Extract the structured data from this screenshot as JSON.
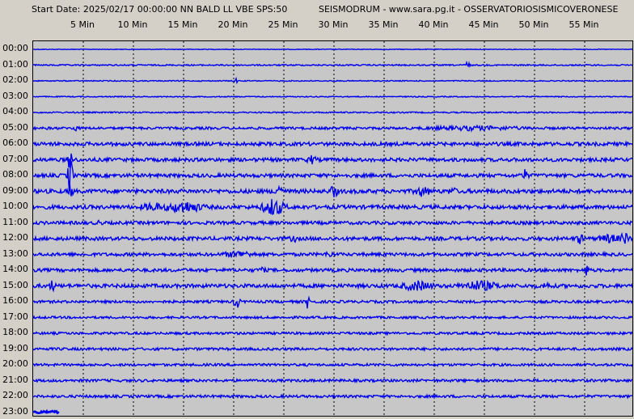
{
  "header": {
    "start_info": "Start Date: 2025/02/17 00:00:00 NN BALD LL VBE SPS:50",
    "station_info": "SEISMODRUM - www.sara.pg.it - OSSERVATORIOSISMICOVERONESE"
  },
  "minute_labels": [
    "5 Min",
    "10 Min",
    "15 Min",
    "20 Min",
    "25 Min",
    "30 Min",
    "35 Min",
    "40 Min",
    "45 Min",
    "50 Min",
    "55 Min"
  ],
  "hour_labels": [
    "00:00",
    "01:00",
    "02:00",
    "03:00",
    "04:00",
    "05:00",
    "06:00",
    "07:00",
    "08:00",
    "09:00",
    "10:00",
    "11:00",
    "12:00",
    "13:00",
    "14:00",
    "15:00",
    "16:00",
    "17:00",
    "18:00",
    "19:00",
    "20:00",
    "21:00",
    "22:00",
    "23:00"
  ],
  "colors": {
    "trace": "#0000ee",
    "background": "#c7c7c7",
    "grid": "#000000",
    "frame": "#d4d0c8"
  },
  "traces": [
    {
      "hour": "00:00",
      "noise": 0.4,
      "events": []
    },
    {
      "hour": "01:00",
      "noise": 0.8,
      "events": [
        {
          "min": 43.3,
          "amp": 6,
          "dur": 0.3
        }
      ]
    },
    {
      "hour": "02:00",
      "noise": 0.6,
      "events": [
        {
          "min": 20.2,
          "amp": 3,
          "dur": 0.3
        }
      ]
    },
    {
      "hour": "03:00",
      "noise": 0.6,
      "events": []
    },
    {
      "hour": "04:00",
      "noise": 0.8,
      "events": []
    },
    {
      "hour": "05:00",
      "noise": 1.5,
      "events": [
        {
          "min": 4.2,
          "amp": 4,
          "dur": 0.3
        },
        {
          "min": 44,
          "amp": 2,
          "dur": 6
        }
      ]
    },
    {
      "hour": "06:00",
      "noise": 2.2,
      "events": []
    },
    {
      "hour": "07:00",
      "noise": 2.2,
      "events": [
        {
          "min": 3.7,
          "amp": 18,
          "dur": 0.3
        },
        {
          "min": 27.8,
          "amp": 4,
          "dur": 0.6
        }
      ]
    },
    {
      "hour": "08:00",
      "noise": 2.2,
      "events": [
        {
          "min": 3.7,
          "amp": 24,
          "dur": 0.4
        },
        {
          "min": 49,
          "amp": 6,
          "dur": 0.5
        }
      ]
    },
    {
      "hour": "09:00",
      "noise": 2.5,
      "events": [
        {
          "min": 3.7,
          "amp": 14,
          "dur": 0.3
        },
        {
          "min": 24.5,
          "amp": 10,
          "dur": 0.5
        },
        {
          "min": 30,
          "amp": 9,
          "dur": 0.4
        },
        {
          "min": 38.8,
          "amp": 5,
          "dur": 1
        },
        {
          "min": 41.8,
          "amp": 4,
          "dur": 0.5
        }
      ]
    },
    {
      "hour": "10:00",
      "noise": 2.4,
      "events": [
        {
          "min": 12,
          "amp": 4,
          "dur": 1.5
        },
        {
          "min": 15,
          "amp": 6,
          "dur": 2.5
        },
        {
          "min": 24,
          "amp": 10,
          "dur": 1.5
        }
      ]
    },
    {
      "hour": "11:00",
      "noise": 2.0,
      "events": [
        {
          "min": 6.6,
          "amp": 3,
          "dur": 0.3
        }
      ]
    },
    {
      "hour": "12:00",
      "noise": 2.2,
      "events": [
        {
          "min": 26,
          "amp": 3,
          "dur": 0.5
        },
        {
          "min": 54.5,
          "amp": 5,
          "dur": 0.5
        },
        {
          "min": 57.5,
          "amp": 4,
          "dur": 1.5
        },
        {
          "min": 59,
          "amp": 7,
          "dur": 0.6
        }
      ]
    },
    {
      "hour": "13:00",
      "noise": 2.0,
      "events": [
        {
          "min": 20.5,
          "amp": 3,
          "dur": 2
        },
        {
          "min": 29.5,
          "amp": 4,
          "dur": 0.4
        }
      ]
    },
    {
      "hour": "14:00",
      "noise": 2.0,
      "events": [
        {
          "min": 22.8,
          "amp": 3,
          "dur": 0.4
        },
        {
          "min": 55.2,
          "amp": 6,
          "dur": 0.4
        }
      ]
    },
    {
      "hour": "15:00",
      "noise": 2.3,
      "events": [
        {
          "min": 1.9,
          "amp": 6,
          "dur": 0.4
        },
        {
          "min": 38.3,
          "amp": 5,
          "dur": 2
        },
        {
          "min": 44.5,
          "amp": 5,
          "dur": 2.5
        },
        {
          "min": 51.2,
          "amp": 5,
          "dur": 0.4
        }
      ]
    },
    {
      "hour": "16:00",
      "noise": 1.6,
      "events": [
        {
          "min": 20.3,
          "amp": 9,
          "dur": 0.4
        },
        {
          "min": 27.4,
          "amp": 8,
          "dur": 0.4
        }
      ]
    },
    {
      "hour": "17:00",
      "noise": 1.4,
      "events": []
    },
    {
      "hour": "18:00",
      "noise": 1.5,
      "events": []
    },
    {
      "hour": "19:00",
      "noise": 1.6,
      "events": []
    },
    {
      "hour": "20:00",
      "noise": 1.5,
      "events": []
    },
    {
      "hour": "21:00",
      "noise": 1.6,
      "events": []
    },
    {
      "hour": "22:00",
      "noise": 1.6,
      "events": []
    },
    {
      "hour": "23:00",
      "noise": 1.5,
      "events": [],
      "end_min": 2.6
    }
  ]
}
